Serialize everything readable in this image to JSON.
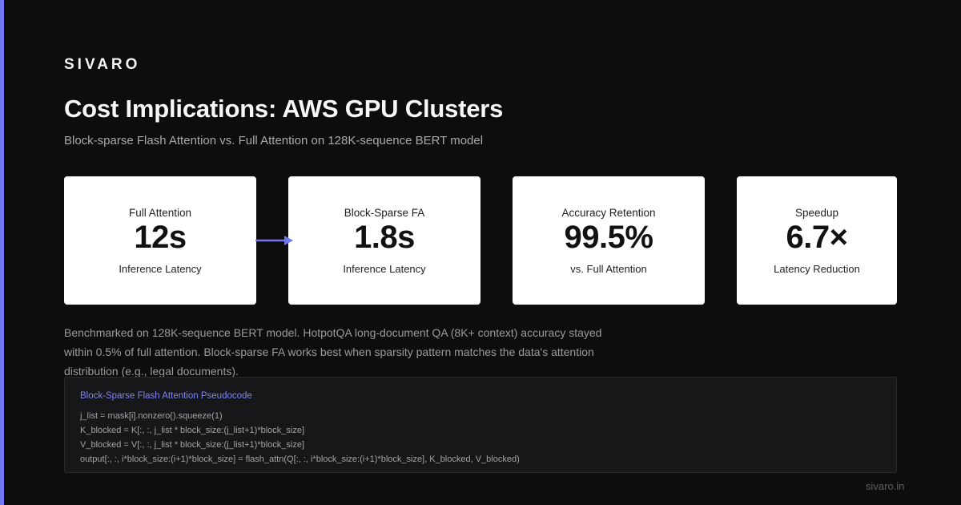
{
  "brand": "SIVARO",
  "title": "Cost Implications: AWS GPU Clusters",
  "subtitle": "Block-sparse Flash Attention vs. Full Attention on 128K-sequence BERT model",
  "cards": [
    {
      "label": "Full Attention",
      "value": "12s",
      "sub": "Inference Latency"
    },
    {
      "label": "Block-Sparse FA",
      "value": "1.8s",
      "sub": "Inference Latency"
    },
    {
      "label": "Accuracy Retention",
      "value": "99.5%",
      "sub": "vs. Full Attention"
    },
    {
      "label": "Speedup",
      "value": "6.7×",
      "sub": "Latency Reduction"
    }
  ],
  "note": "Benchmarked on 128K-sequence BERT model. HotpotQA long-document QA (8K+ context) accuracy stayed within 0.5% of full attention. Block-sparse FA works best when sparsity pattern matches the data's attention distribution (e.g., legal documents).",
  "code": {
    "title": "Block-Sparse Flash Attention Pseudocode",
    "lines": [
      "j_list = mask[i].nonzero().squeeze(1)",
      "K_blocked = K[:, :, j_list * block_size:(j_list+1)*block_size]",
      "V_blocked = V[:, :, j_list * block_size:(j_list+1)*block_size]",
      "output[:, :, i*block_size:(i+1)*block_size] = flash_attn(Q[:, :, i*block_size:(i+1)*block_size], K_blocked, V_blocked)"
    ]
  },
  "footer": "sivaro.in",
  "colors": {
    "background": "#0e0d0e",
    "accent": "#7177f0",
    "card": "#ffffff"
  },
  "icons": {
    "connector": "arrow-right-icon"
  }
}
